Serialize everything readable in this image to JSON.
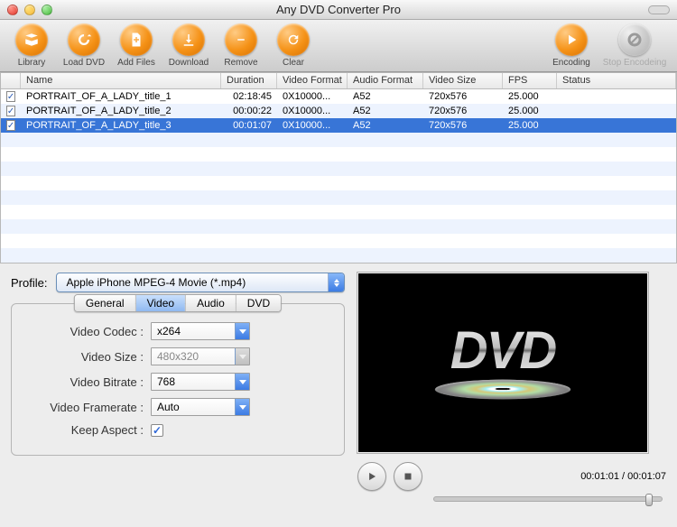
{
  "window": {
    "title": "Any DVD Converter Pro"
  },
  "toolbar": {
    "library": "Library",
    "loaddvd": "Load DVD",
    "addfiles": "Add Files",
    "download": "Download",
    "remove": "Remove",
    "clear": "Clear",
    "encoding": "Encoding",
    "stop": "Stop Encodeing"
  },
  "table": {
    "headers": {
      "name": "Name",
      "duration": "Duration",
      "vformat": "Video Format",
      "aformat": "Audio Format",
      "vsize": "Video Size",
      "fps": "FPS",
      "status": "Status"
    },
    "rows": [
      {
        "checked": true,
        "selected": false,
        "name": "PORTRAIT_OF_A_LADY_title_1",
        "duration": "02:18:45",
        "vformat": "0X10000...",
        "aformat": "A52",
        "vsize": "720x576",
        "fps": "25.000",
        "status": ""
      },
      {
        "checked": true,
        "selected": false,
        "name": "PORTRAIT_OF_A_LADY_title_2",
        "duration": "00:00:22",
        "vformat": "0X10000...",
        "aformat": "A52",
        "vsize": "720x576",
        "fps": "25.000",
        "status": ""
      },
      {
        "checked": true,
        "selected": true,
        "name": "PORTRAIT_OF_A_LADY_title_3",
        "duration": "00:01:07",
        "vformat": "0X10000...",
        "aformat": "A52",
        "vsize": "720x576",
        "fps": "25.000",
        "status": ""
      }
    ]
  },
  "profile": {
    "label": "Profile:",
    "value": "Apple iPhone MPEG-4 Movie (*.mp4)"
  },
  "tabs": {
    "general": "General",
    "video": "Video",
    "audio": "Audio",
    "dvd": "DVD",
    "active": "video"
  },
  "settings": {
    "videoCodec": {
      "label": "Video Codec :",
      "value": "x264",
      "enabled": true
    },
    "videoSize": {
      "label": "Video Size :",
      "value": "480x320",
      "enabled": false
    },
    "videoBitrate": {
      "label": "Video Bitrate :",
      "value": "768",
      "enabled": true
    },
    "videoFramerate": {
      "label": "Video Framerate :",
      "value": "Auto",
      "enabled": true
    },
    "keepAspect": {
      "label": "Keep Aspect :",
      "checked": true
    }
  },
  "player": {
    "time": "00:01:01 / 00:01:07",
    "progress": 0.93
  }
}
